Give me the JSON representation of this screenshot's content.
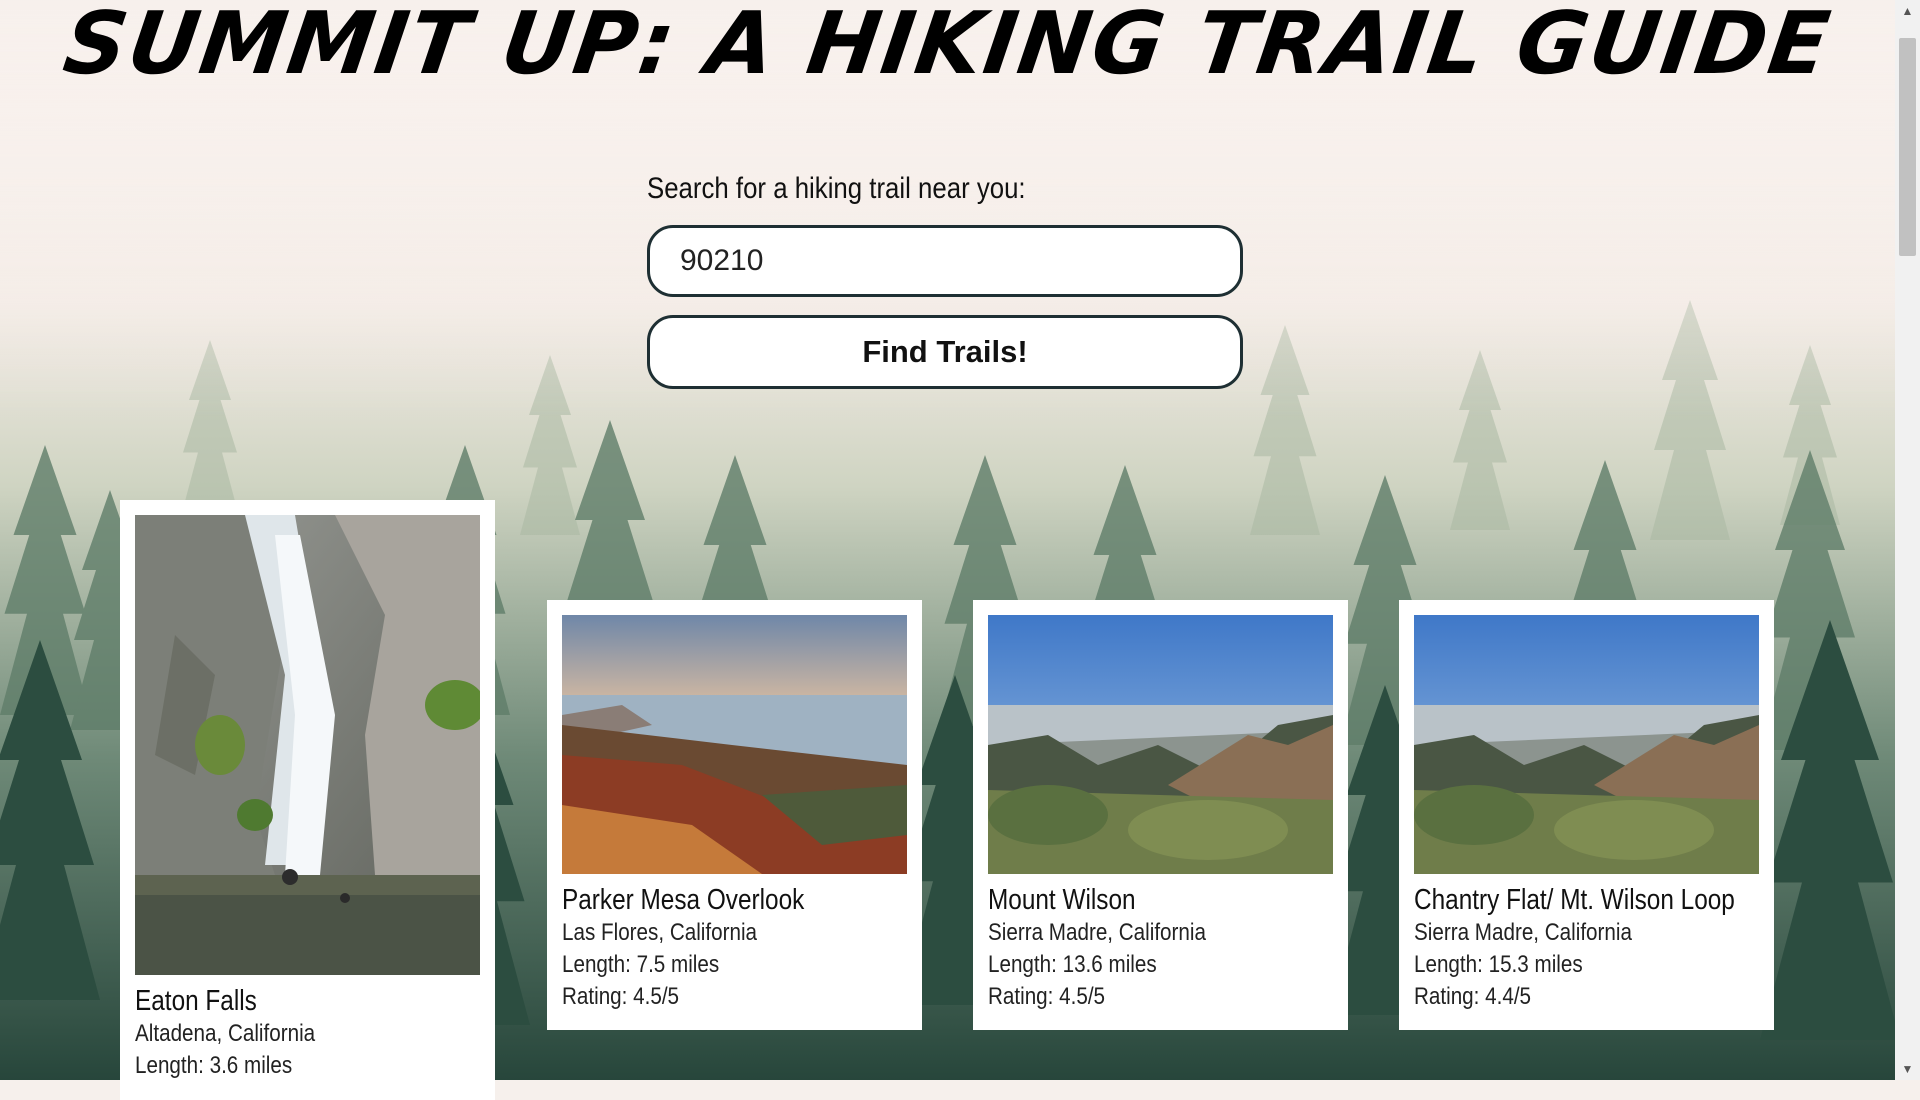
{
  "header": {
    "title": "SUMMIT UP: A HIKING TRAIL GUIDE"
  },
  "search": {
    "label": "Search for a hiking trail near you:",
    "value": "90210",
    "button_label": "Find Trails!"
  },
  "trails": [
    {
      "name": "Eaton Falls",
      "location": "Altadena, California",
      "length": "Length: 3.6 miles",
      "rating": ""
    },
    {
      "name": "Parker Mesa Overlook",
      "location": "Las Flores, California",
      "length": "Length: 7.5 miles",
      "rating": "Rating: 4.5/5"
    },
    {
      "name": "Mount Wilson",
      "location": "Sierra Madre, California",
      "length": "Length: 13.6 miles",
      "rating": "Rating: 4.5/5"
    },
    {
      "name": "Chantry Flat/ Mt. Wilson Loop",
      "location": "Sierra Madre, California",
      "length": "Length: 15.3 miles",
      "rating": "Rating: 4.4/5"
    }
  ],
  "colors": {
    "button_border": "#1e2f33",
    "forest_dark": "#1f3d33",
    "fog": "#f6efea"
  }
}
